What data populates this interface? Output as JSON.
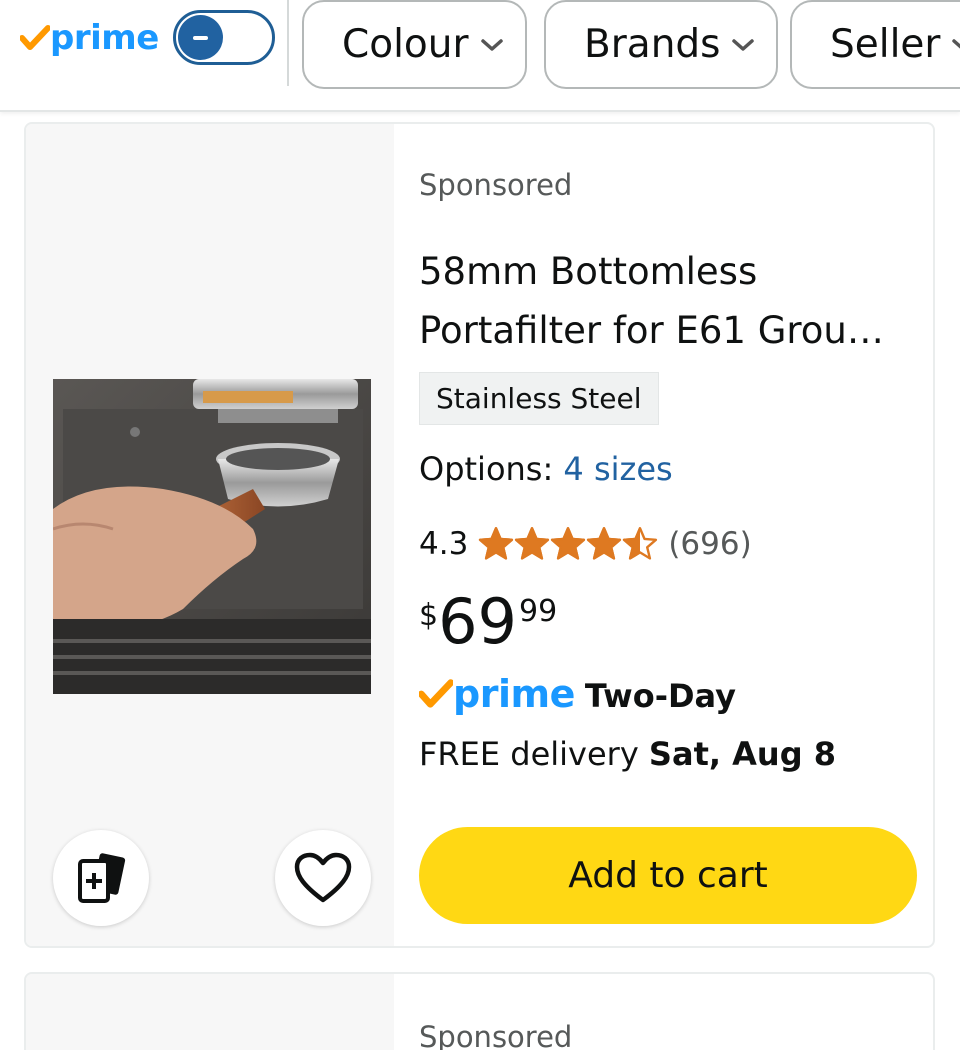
{
  "filter_bar": {
    "prime_label": "prime",
    "prime_toggle_state": "off",
    "chips": [
      {
        "label": "Colour"
      },
      {
        "label": "Brands"
      },
      {
        "label": "Seller"
      }
    ]
  },
  "product": {
    "sponsored_label": "Sponsored",
    "title_line1": "58mm Bottomless",
    "title_line2": "Portafilter for E61 Grou…",
    "badge": "Stainless Steel",
    "options_label": "Options:",
    "options_value": "4 sizes",
    "rating": "4.3",
    "rating_stars": 4.3,
    "rating_count": "(696)",
    "price_symbol": "$",
    "price_whole": "69",
    "price_fraction": "99",
    "prime_label": "prime",
    "prime_speed": "Two-Day",
    "delivery_prefix": "FREE delivery",
    "delivery_date": "Sat, Aug 8",
    "add_to_cart": "Add to cart"
  },
  "next_product": {
    "sponsored_label": "Sponsored"
  },
  "colors": {
    "prime_blue": "#1a98ff",
    "prime_check": "#ff9900",
    "star": "#de7921",
    "link": "#2162a1",
    "add_to_cart": "#ffd814"
  }
}
